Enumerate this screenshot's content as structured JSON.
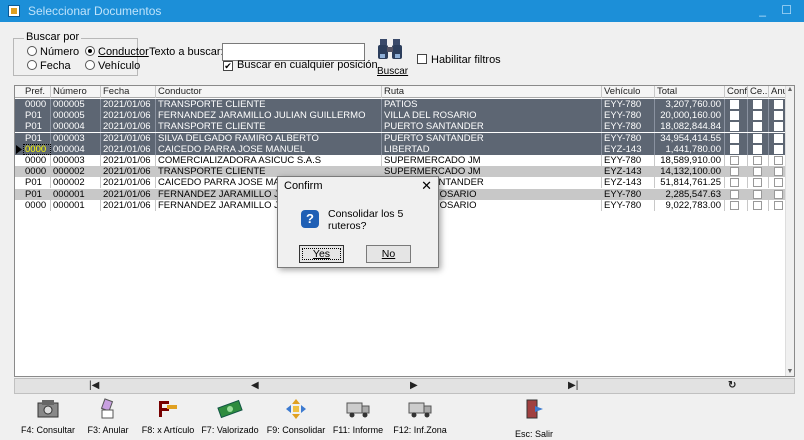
{
  "window": {
    "title": "Seleccionar Documentos"
  },
  "search": {
    "group_label": "Buscar por",
    "options": [
      {
        "label": "Número",
        "checked": false
      },
      {
        "label": "Conductor",
        "checked": true
      },
      {
        "label": "Fecha",
        "checked": false
      },
      {
        "label": "Vehículo",
        "checked": false
      }
    ],
    "text_label": "Texto a buscar:",
    "text_value": "",
    "anywhere_label": "Buscar en cualquier posición",
    "anywhere_checked": true,
    "buscar_label": "Buscar",
    "filters_label": "Habilitar filtros",
    "filters_checked": false
  },
  "grid": {
    "columns": [
      "Pref.",
      "Número",
      "Fecha",
      "Conductor",
      "Ruta",
      "Vehículo",
      "Total",
      "Conf...",
      "Ce...",
      "Anul"
    ],
    "rows": [
      {
        "pref": "0000",
        "num": "000005",
        "fecha": "2021/01/06",
        "conductor": "TRANSPORTE CLIENTE",
        "ruta": "PATIOS",
        "vehiculo": "EYY-780",
        "total": "3,207,760.00",
        "style": "sel"
      },
      {
        "pref": "P01",
        "num": "000005",
        "fecha": "2021/01/06",
        "conductor": "FERNANDEZ JARAMILLO JULIAN GUILLERMO",
        "ruta": "VILLA DEL ROSARIO",
        "vehiculo": "EYY-780",
        "total": "20,000,160.00",
        "style": "sel"
      },
      {
        "pref": "P01",
        "num": "000004",
        "fecha": "2021/01/06",
        "conductor": "TRANSPORTE CLIENTE",
        "ruta": "PUERTO SANTANDER",
        "vehiculo": "EYY-780",
        "total": "18,082,844.84",
        "style": "sel"
      },
      {
        "pref": "P01",
        "num": "000003",
        "fecha": "2021/01/06",
        "conductor": "SILVA DELGADO RAMIRO ALBERTO",
        "ruta": "PUERTO SANTANDER",
        "vehiculo": "EYY-780",
        "total": "34,954,414.55",
        "style": "sel"
      },
      {
        "pref": "0000",
        "num": "000004",
        "fecha": "2021/01/06",
        "conductor": "CAICEDO PARRA JOSE MANUEL",
        "ruta": "LIBERTAD",
        "vehiculo": "EYZ-143",
        "total": "1,441,780.00",
        "style": "sel"
      },
      {
        "pref": "0000",
        "num": "000003",
        "fecha": "2021/01/06",
        "conductor": "COMERCIALIZADORA ASICUC S.A.S",
        "ruta": "SUPERMERCADO JM",
        "vehiculo": "EYY-780",
        "total": "18,589,910.00",
        "style": "white"
      },
      {
        "pref": "0000",
        "num": "000002",
        "fecha": "2021/01/06",
        "conductor": "TRANSPORTE CLIENTE",
        "ruta": "SUPERMERCADO JM",
        "vehiculo": "EYZ-143",
        "total": "14,132,100.00",
        "style": "alt"
      },
      {
        "pref": "P01",
        "num": "000002",
        "fecha": "2021/01/06",
        "conductor": "CAICEDO PARRA JOSE MANUEL",
        "ruta": "PUERTO SANTANDER",
        "vehiculo": "EYZ-143",
        "total": "51,814,761.25",
        "style": "white"
      },
      {
        "pref": "P01",
        "num": "000001",
        "fecha": "2021/01/06",
        "conductor": "FERNANDEZ JARAMILLO JULIAN GUILLERMO",
        "ruta": "VILLA DEL ROSARIO",
        "vehiculo": "EYY-780",
        "total": "2,285,547.63",
        "style": "alt"
      },
      {
        "pref": "0000",
        "num": "000001",
        "fecha": "2021/01/06",
        "conductor": "FERNANDEZ JARAMILLO JULIAN GUILLERMO",
        "ruta": "VILLA DEL ROSARIO",
        "vehiculo": "EYY-780",
        "total": "9,022,783.00",
        "style": "white"
      }
    ]
  },
  "nav": {
    "first": "|◀",
    "prev": "◀",
    "next": "▶",
    "last": "▶|",
    "refresh": "↻"
  },
  "toolbar": [
    {
      "label": "F4: Consultar",
      "icon": "camera-icon"
    },
    {
      "label": "F3: Anular",
      "icon": "eraser-icon"
    },
    {
      "label": "F8: x Artículo",
      "icon": "key-icon"
    },
    {
      "label": "F7: Valorizado",
      "icon": "money-icon"
    },
    {
      "label": "F9: Consolidar",
      "icon": "arrows-icon"
    },
    {
      "label": "F11: Informe",
      "icon": "truck-icon"
    },
    {
      "label": "F12: Inf.Zona",
      "icon": "truck-zone-icon"
    },
    {
      "label": "Esc: Salir",
      "icon": "exit-icon"
    }
  ],
  "dialog": {
    "title": "Confirm",
    "message": "Consolidar los 5 ruteros?",
    "yes": "Yes",
    "no": "No"
  },
  "colors": {
    "titlebar": "#1c8fd8",
    "selected_row": "#5d6673",
    "alt_row": "#c8c8c8"
  }
}
